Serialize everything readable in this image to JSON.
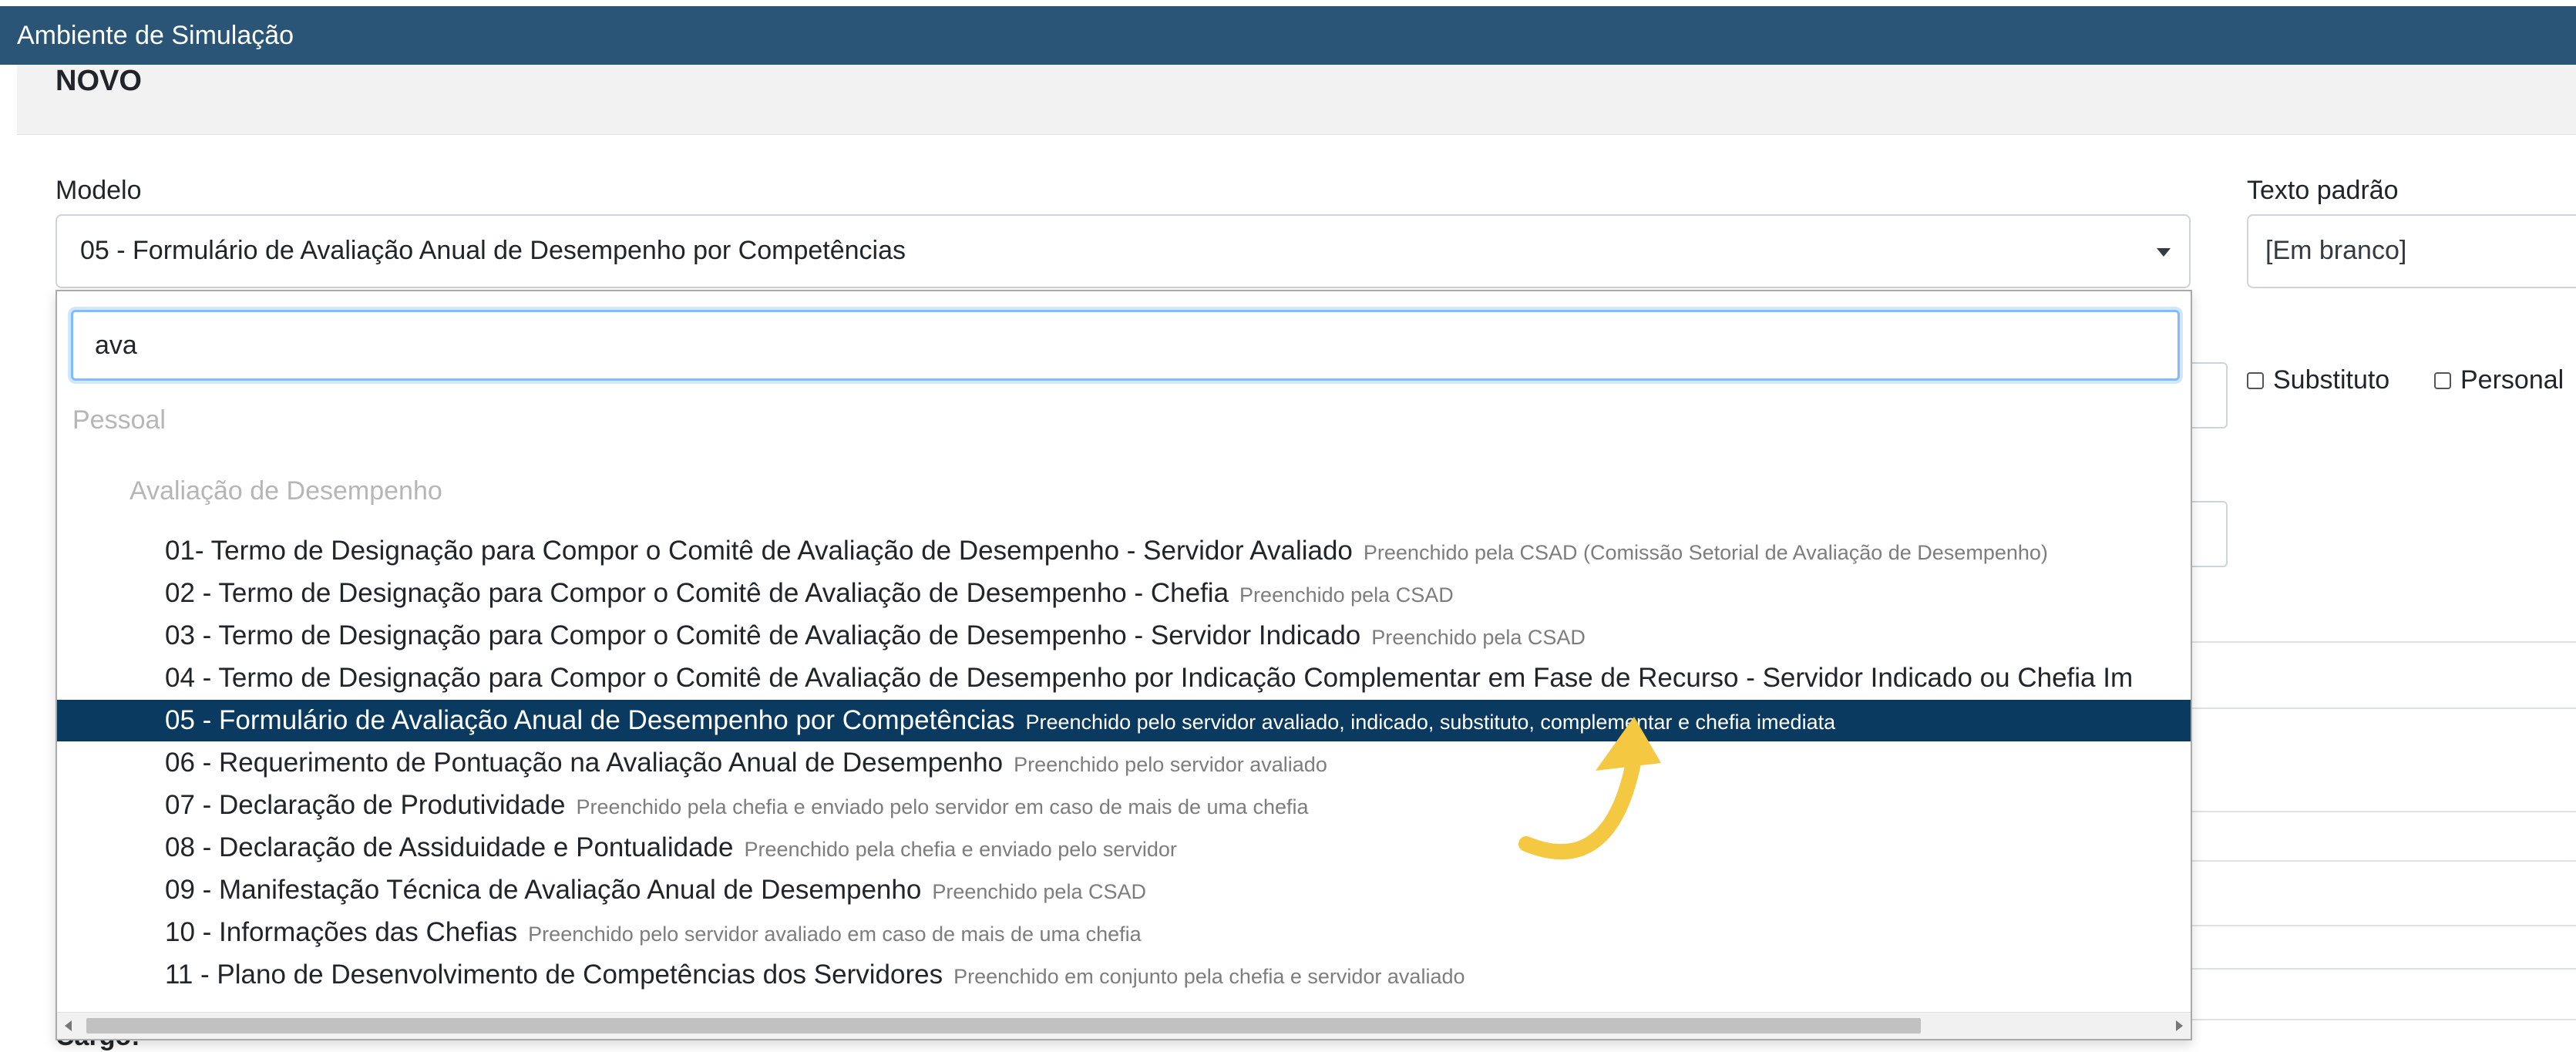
{
  "window": {
    "title": "Ambiente de Simulação"
  },
  "page": {
    "title": "NOVO"
  },
  "form": {
    "modelo_label": "Modelo",
    "modelo_value": "05 - Formulário de Avaliação Anual de Desempenho por Competências",
    "texto_padrao_label": "Texto padrão",
    "texto_padrao_value": "[Em branco]",
    "checkbox_substituto": "Substituto",
    "checkbox_personal": "Personal",
    "cargo_label": "Cargo:"
  },
  "dropdown": {
    "search_value": "ava",
    "group_label": "Pessoal",
    "subgroup_label": "Avaliação de Desempenho",
    "options": [
      {
        "label": "01- Termo de Designação para Compor o Comitê de Avaliação de Desempenho - Servidor Avaliado",
        "note": "Preenchido pela CSAD (Comissão Setorial de Avaliação de Desempenho)"
      },
      {
        "label": "02 - Termo de Designação para Compor o Comitê de Avaliação de Desempenho - Chefia",
        "note": "Preenchido pela CSAD"
      },
      {
        "label": "03 - Termo de Designação para Compor o Comitê de Avaliação de Desempenho - Servidor Indicado",
        "note": "Preenchido pela CSAD"
      },
      {
        "label": "04 - Termo de Designação para Compor o Comitê de Avaliação de Desempenho por Indicação Complementar em Fase de Recurso - Servidor Indicado ou Chefia Im",
        "note": ""
      },
      {
        "label": "05 - Formulário de Avaliação Anual de Desempenho por Competências",
        "note": "Preenchido pelo servidor avaliado, indicado, substituto, complementar e chefia imediata"
      },
      {
        "label": "06 - Requerimento de Pontuação na Avaliação Anual de Desempenho",
        "note": "Preenchido pelo servidor avaliado"
      },
      {
        "label": "07 - Declaração de Produtividade",
        "note": "Preenchido pela chefia e enviado pelo servidor em caso de mais de uma chefia"
      },
      {
        "label": "08 - Declaração de Assiduidade e Pontualidade",
        "note": "Preenchido pela chefia e enviado pelo servidor"
      },
      {
        "label": "09 - Manifestação Técnica de Avaliação Anual de Desempenho",
        "note": "Preenchido pela CSAD"
      },
      {
        "label": "10 - Informações das Chefias",
        "note": "Preenchido pelo servidor avaliado em caso de mais de uma chefia"
      },
      {
        "label": "11 - Plano de Desenvolvimento de Competências dos Servidores",
        "note": "Preenchido em conjunto pela chefia e servidor avaliado"
      }
    ]
  },
  "colors": {
    "topbar": "#2a5577",
    "selected_option": "#0b3a60",
    "focus_ring": "#80bdff",
    "annotation_arrow": "#f5c842"
  }
}
